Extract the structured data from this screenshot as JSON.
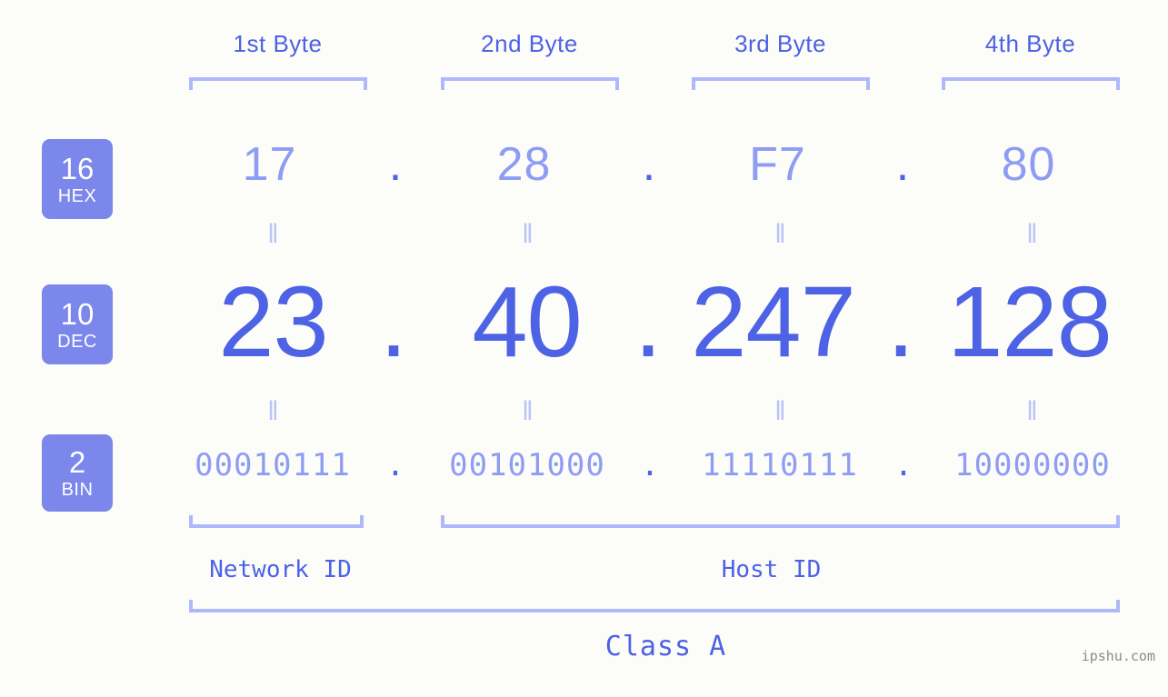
{
  "background_color": "#fcfdf8",
  "accent_color": "#4d62e5",
  "light_accent_color": "#8e9cf4",
  "bracket_color": "#aeb8fb",
  "badge_color": "#7b87ea",
  "byte_headers": [
    {
      "label": "1st Byte"
    },
    {
      "label": "2nd Byte"
    },
    {
      "label": "3rd Byte"
    },
    {
      "label": "4th Byte"
    }
  ],
  "rows": {
    "hex": {
      "base_number": "16",
      "base_name": "HEX",
      "values": [
        "17",
        "28",
        "F7",
        "80"
      ],
      "separator": "."
    },
    "dec": {
      "base_number": "10",
      "base_name": "DEC",
      "values": [
        "23",
        "40",
        "247",
        "128"
      ],
      "separator": "."
    },
    "bin": {
      "base_number": "2",
      "base_name": "BIN",
      "values": [
        "00010111",
        "00101000",
        "11110111",
        "10000000"
      ],
      "separator": "."
    }
  },
  "equals_marks": [
    "‖",
    "‖",
    "‖",
    "‖"
  ],
  "segments": {
    "network_id": "Network ID",
    "host_id": "Host ID"
  },
  "class_label": "Class A",
  "watermark": "ipshu.com",
  "ip_address": "23.40.247.128"
}
